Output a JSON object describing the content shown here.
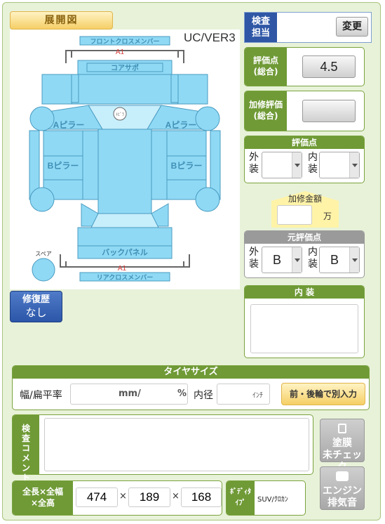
{
  "header": {
    "tenkaizu": "展開図",
    "ver": "UC/VER3"
  },
  "diagram": {
    "front_cross": "フロントクロスメンバー",
    "core_support": "コアサポ",
    "a_pillar_l": "Aピラー",
    "a_pillar_r": "Aピラー",
    "b_pillar_l": "Bピラー",
    "b_pillar_r": "Bピラー",
    "back_panel": "バックパネル",
    "rear_cross": "リアクロスメンバー",
    "spare": "スペア",
    "a1_top": "A1",
    "a1_bottom": "A1",
    "tobira": "ﾄﾋﾞﾗ"
  },
  "repair": {
    "label": "修復歴",
    "value": "なし"
  },
  "inspector": {
    "label1": "検査",
    "label2": "担当",
    "button": "変更"
  },
  "score": {
    "label1": "評価点",
    "label2": "(総合)",
    "value": "4.5"
  },
  "kashu": {
    "label1": "加修評価",
    "label2": "(総合)",
    "value": ""
  },
  "hyoka": {
    "title": "評価点",
    "gai1": "外",
    "gai2": "装",
    "nai1": "内",
    "nai2": "装",
    "gai_value": "",
    "nai_value": ""
  },
  "kashu_kingaku": {
    "label": "加修金額",
    "unit": "万",
    "value": ""
  },
  "moto_hyoka": {
    "title": "元評価点",
    "gai1": "外",
    "gai2": "装",
    "nai1": "内",
    "nai2": "装",
    "gai_value": "B",
    "nai_value": "B"
  },
  "naisou": {
    "title": "内 装",
    "value": ""
  },
  "tire": {
    "title": "タイヤサイズ",
    "width_label": "幅/扁平率",
    "mm": "mm/",
    "percent": "%",
    "inner_label": "内径",
    "inch": "ｲﾝﾁ",
    "button": "前・後輪で別入力"
  },
  "comment": {
    "label": "検査コメント",
    "value": ""
  },
  "side_buttons": {
    "toumaku1": "塗膜",
    "toumaku2": "未チェック",
    "engine1": "エンジン",
    "engine2": "排気音"
  },
  "dims": {
    "label1": "全長×全幅",
    "label2": "×全高",
    "length": "474",
    "width": "189",
    "height": "168",
    "x1": "×",
    "x2": "×"
  },
  "body_type": {
    "label1": "ﾎﾞﾃﾞｨﾀ",
    "label2": "ｲﾌﾟ",
    "value": "SUV/ｸﾛｶﾝ"
  },
  "colors": {
    "accent_green": "#6f9a36",
    "part_blue": "#8fd9f5",
    "repair_blue": "#2c56a8"
  }
}
